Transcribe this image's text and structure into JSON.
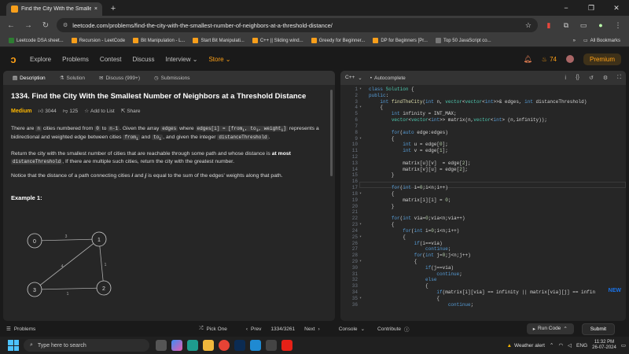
{
  "browser": {
    "tab_title": "Find the City With the Smallest",
    "tab_close": "×",
    "new_tab": "+",
    "url": "leetcode.com/problems/find-the-city-with-the-smallest-number-of-neighbors-at-a-threshold-distance/",
    "window_controls": {
      "minimize": "−",
      "maximize": "❐",
      "close": "✕"
    }
  },
  "bookmarks": {
    "items": [
      {
        "label": "Leetcode DSA sheet...",
        "color": "#2e7d32"
      },
      {
        "label": "Recursion - LeetCode",
        "color": "#f89f1b"
      },
      {
        "label": "Bit Manipulation - L...",
        "color": "#f89f1b"
      },
      {
        "label": "Start Bit Manipulati...",
        "color": "#f89f1b"
      },
      {
        "label": "C++ || Sliding wind...",
        "color": "#f89f1b"
      },
      {
        "label": "Greedy for Beginner...",
        "color": "#f89f1b"
      },
      {
        "label": "DP for Beginners [Pr...",
        "color": "#f89f1b"
      },
      {
        "label": "Top 50 JavaScript co...",
        "color": "#333333"
      }
    ],
    "all_bookmarks": "All Bookmarks"
  },
  "lc_header": {
    "nav": [
      "Explore",
      "Problems",
      "Contest",
      "Discuss",
      "Interview ⌄",
      "Store ⌄"
    ],
    "streak": "74",
    "premium": "Premium"
  },
  "left_tabs": [
    "Description",
    "Solution",
    "Discuss (999+)",
    "Submissions"
  ],
  "problem": {
    "number_title": "1334. Find the City With the Smallest Number of Neighbors at a Threshold Distance",
    "difficulty": "Medium",
    "likes": "3044",
    "dislikes": "125",
    "add_to_list": "Add to List",
    "share": "Share",
    "para1_parts": [
      "There are ",
      "n",
      " cities numbered from ",
      "0",
      " to ",
      "n-1",
      ". Given the array ",
      "edges",
      " where ",
      "edges[i] = [from",
      "i",
      ", to",
      "i",
      ", weight",
      "i",
      "]",
      " represents a bidirectional and weighted edge between cities ",
      "from",
      "i",
      " and ",
      "to",
      "i",
      ", and given the integer ",
      "distanceThreshold",
      "."
    ],
    "para2_a": "Return the city with the smallest number of cities that are reachable through some path and whose distance is ",
    "para2_bold": "at most",
    "para2_code": "distanceThreshold",
    "para2_b": ", If there are multiple such cities, return the city with the greatest number.",
    "para3_a": "Notice that the distance of a path connecting cities ",
    "para3_i": "i",
    "para3_and": " and ",
    "para3_j": "j",
    "para3_b": " is equal to the sum of the edges' weights along that path.",
    "example_heading": "Example 1:",
    "graph_nodes": [
      "0",
      "1",
      "2",
      "3"
    ],
    "graph_weights": [
      "3",
      "4",
      "1",
      "1"
    ]
  },
  "editor": {
    "language": "C++",
    "autocomplete": "Autocomplete",
    "new_badge": "NEW",
    "line_count": 36
  },
  "bottom": {
    "problems": "Problems",
    "pick_one": "Pick One",
    "prev": "Prev",
    "counter": "1334/3261",
    "next": "Next",
    "console": "Console",
    "contribute": "Contribute",
    "run_code": "Run Code",
    "submit": "Submit"
  },
  "taskbar": {
    "search": "Type here to search",
    "weather": "Weather alert",
    "lang": "ENG",
    "time": "11:32 PM",
    "date": "26-07-2024"
  }
}
